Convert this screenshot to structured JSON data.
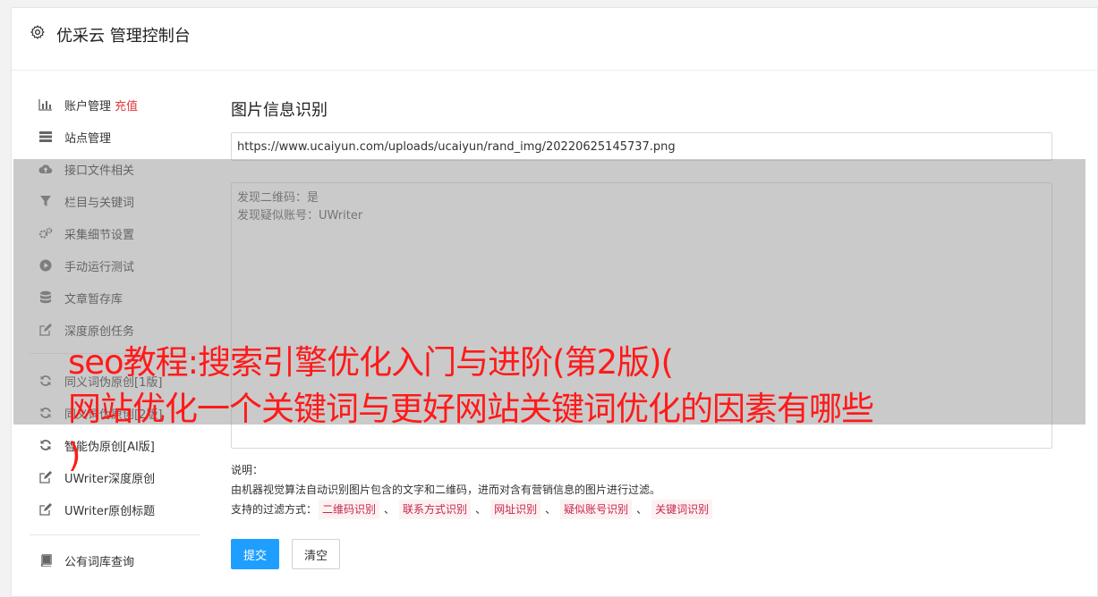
{
  "app": {
    "title": "优采云 管理控制台"
  },
  "sidebar": {
    "items": [
      {
        "label": "账户管理",
        "icon": "bar-chart-icon",
        "extra": "充值"
      },
      {
        "label": "站点管理",
        "icon": "server-icon"
      },
      {
        "label": "接口文件相关",
        "icon": "cloud-upload-icon"
      },
      {
        "label": "栏目与关键词",
        "icon": "filter-icon"
      },
      {
        "label": "采集细节设置",
        "icon": "cogs-icon"
      },
      {
        "label": "手动运行测试",
        "icon": "play-circle-icon"
      },
      {
        "label": "文章暂存库",
        "icon": "database-icon"
      },
      {
        "label": "深度原创任务",
        "icon": "edit-icon"
      },
      {
        "label": "同义词伪原创[1版]",
        "icon": "refresh-icon"
      },
      {
        "label": "同义词伪原创[2版]",
        "icon": "refresh-icon"
      },
      {
        "label": "智能伪原创[AI版]",
        "icon": "refresh-icon"
      },
      {
        "label": "UWriter深度原创",
        "icon": "edit-icon"
      },
      {
        "label": "UWriter原创标题",
        "icon": "edit-icon"
      },
      {
        "label": "公有词库查询",
        "icon": "book-icon"
      }
    ]
  },
  "main": {
    "title": "图片信息识别",
    "url_value": "https://www.ucaiyun.com/uploads/ucaiyun/rand_img/20220625145737.png",
    "result_lines": [
      "发现二维码：是",
      "发现疑似账号：UWriter"
    ],
    "desc_label": "说明：",
    "desc_text": "由机器视觉算法自动识别图片包含的文字和二维码，进而对含有营销信息的图片进行过滤。",
    "filter_label": "支持的过滤方式：",
    "filters": [
      "二维码识别",
      "联系方式识别",
      "网址识别",
      "疑似账号识别",
      "关键词识别"
    ],
    "filter_sep": "、",
    "submit_label": "提交",
    "clear_label": "清空"
  },
  "overlay": {
    "line1": "seo教程:搜索引擎优化入门与进阶(第2版)(",
    "line2": "网站优化一个关键词与更好网站关键词优化的因素有哪些",
    "line3": ")"
  },
  "colors": {
    "accent": "#1e9fff",
    "recharge": "#e4393c",
    "overlay_text": "#ff1a1a",
    "tag_text": "#c7254e"
  }
}
